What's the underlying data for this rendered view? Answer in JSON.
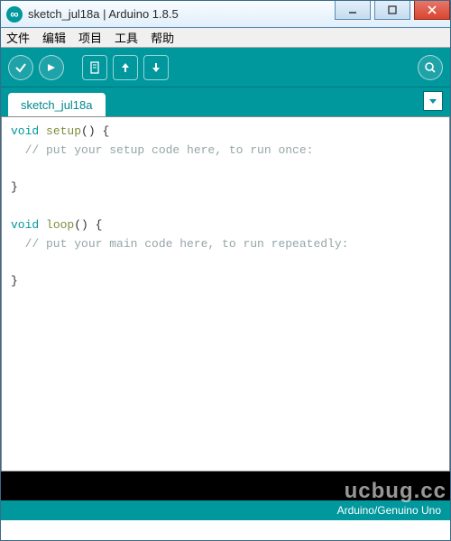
{
  "window": {
    "title": "sketch_jul18a | Arduino 1.8.5"
  },
  "menubar": {
    "items": [
      "文件",
      "编辑",
      "项目",
      "工具",
      "帮助"
    ]
  },
  "toolbar": {
    "verify_tip": "verify",
    "upload_tip": "upload",
    "new_tip": "new",
    "open_tip": "open",
    "save_tip": "save",
    "serial_tip": "serial-monitor"
  },
  "tabs": {
    "active": "sketch_jul18a"
  },
  "editor": {
    "lines": [
      {
        "type": "code",
        "kw": "void",
        "fn": "setup",
        "rest": "() {"
      },
      {
        "type": "comment",
        "text": "  // put your setup code here, to run once:"
      },
      {
        "type": "blank",
        "text": ""
      },
      {
        "type": "plain",
        "text": "}"
      },
      {
        "type": "blank",
        "text": ""
      },
      {
        "type": "code",
        "kw": "void",
        "fn": "loop",
        "rest": "() {"
      },
      {
        "type": "comment",
        "text": "  // put your main code here, to run repeatedly:"
      },
      {
        "type": "blank",
        "text": ""
      },
      {
        "type": "plain",
        "text": "}"
      }
    ]
  },
  "status": {
    "board": "Arduino/Genuino Uno"
  },
  "watermark": "ucbug.cc"
}
